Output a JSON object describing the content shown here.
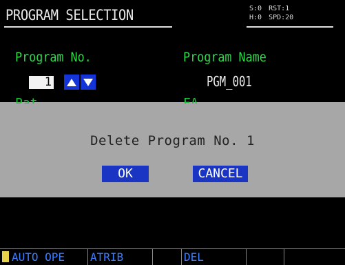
{
  "header": {
    "title": "PROGRAM SELECTION",
    "status": {
      "left_top": "S:0",
      "left_bottom": "H:0",
      "right_top": "RST:1",
      "right_bottom": "SPD:20"
    }
  },
  "fields": {
    "program_no_label": "Program No.",
    "program_no_value": "1",
    "program_name_label": "Program Name",
    "program_name_value": "PGM_001",
    "partial_left_label": "Pat",
    "partial_right_label": "FA"
  },
  "dialog": {
    "message": "Delete Program No.  1",
    "ok_label": "OK",
    "cancel_label": "CANCEL"
  },
  "function_keys": [
    {
      "label": "AUTO OPE"
    },
    {
      "label": "ATRIB"
    },
    {
      "label": ""
    },
    {
      "label": "DEL"
    },
    {
      "label": ""
    },
    {
      "label": ""
    }
  ],
  "icons": {
    "up": "arrow-up-icon",
    "down": "arrow-down-icon",
    "fkey": "function-key-marker-icon"
  },
  "colors": {
    "label_green": "#2fd84a",
    "button_blue": "#1a34c4",
    "dialog_gray": "#a7a7a7",
    "fkey_text": "#3b7dff"
  }
}
